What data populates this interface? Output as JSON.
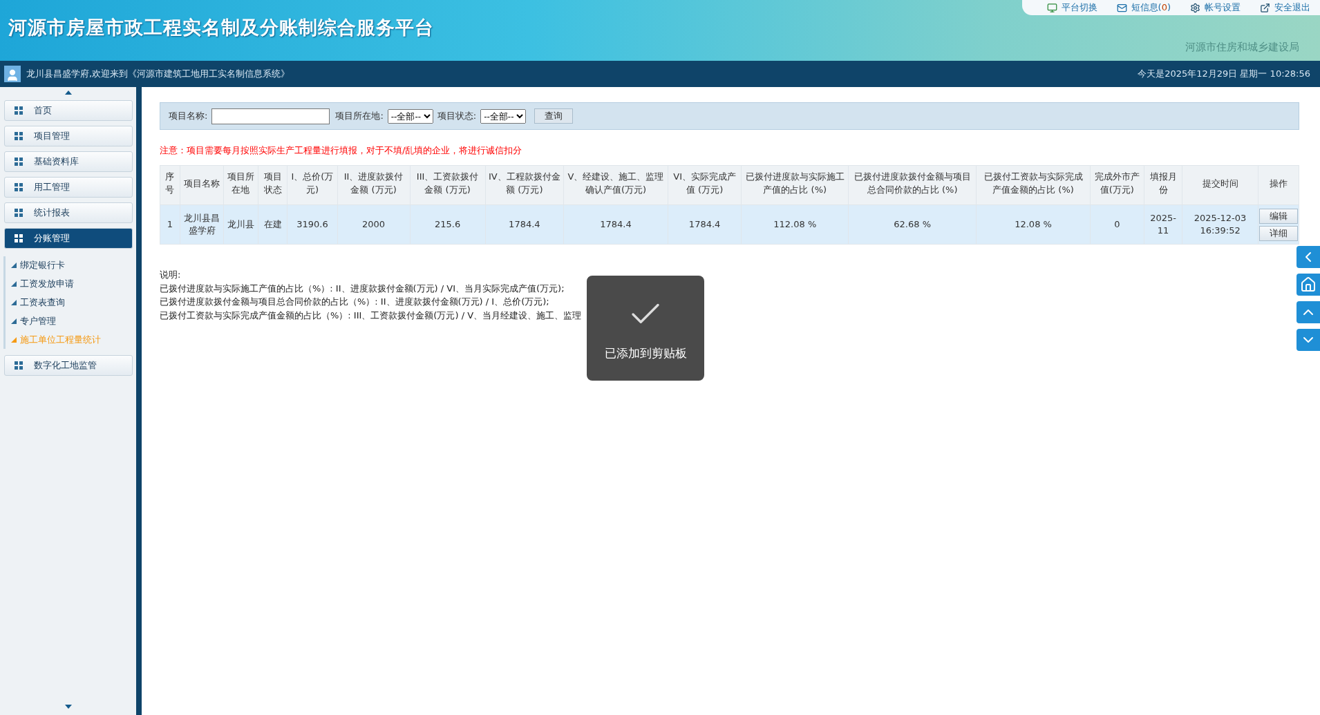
{
  "header": {
    "title": "河源市房屋市政工程实名制及分账制综合服务平台",
    "subtitle": "河源市住房和城乡建设局",
    "links": [
      {
        "kind": "platform",
        "label": "平台切换"
      },
      {
        "kind": "mail",
        "label": "短信息(",
        "count": "0",
        "suffix": ")"
      },
      {
        "kind": "settings",
        "label": "帐号设置"
      },
      {
        "kind": "logout",
        "label": "安全退出"
      }
    ]
  },
  "welcome_bar": {
    "welcome": "龙川县昌盛学府,欢迎来到《河源市建筑工地用工实名制信息系统》",
    "datetime": "今天是2025年12月29日 星期一 10:28:56"
  },
  "sidebar": {
    "items": [
      {
        "label": "首页",
        "selected": false
      },
      {
        "label": "项目管理",
        "selected": false
      },
      {
        "label": "基础资料库",
        "selected": false
      },
      {
        "label": "用工管理",
        "selected": false
      },
      {
        "label": "统计报表",
        "selected": false
      },
      {
        "label": "分账管理",
        "selected": true,
        "expanded": true,
        "children": [
          {
            "label": "绑定银行卡",
            "selected": false
          },
          {
            "label": "工资发放申请",
            "selected": false
          },
          {
            "label": "工资表查询",
            "selected": false
          },
          {
            "label": "专户管理",
            "selected": false
          },
          {
            "label": "施工单位工程量统计",
            "selected": true
          }
        ]
      },
      {
        "label": "数字化工地监管",
        "selected": false
      }
    ]
  },
  "filter": {
    "name_label": "项目名称:",
    "location_label": "项目所在地:",
    "location_value": "--全部--",
    "status_label": "项目状态:",
    "status_value": "--全部--",
    "query_button": "查询"
  },
  "notice": "注意：项目需要每月按照实际生产工程量进行填报，对于不填/乱填的企业，将进行诚信扣分",
  "table": {
    "columns": [
      "序号",
      "项目名称",
      "项目所在地",
      "项目状态",
      "I、总价(万元)",
      "II、进度款拨付金额 (万元)",
      "III、工资款拨付金额 (万元)",
      "IV、工程款拨付金额 (万元)",
      "V、经建设、施工、监理确认产值(万元)",
      "VI、实际完成产值 (万元)",
      "已拨付进度款与实际施工产值的占比 (%)",
      "已拨付进度款拨付金额与项目总合同价款的占比 (%)",
      "已拨付工资款与实际完成产值金额的占比 (%)",
      "完成外市产值(万元)",
      "填报月份",
      "提交时间",
      "操作"
    ],
    "rows": [
      {
        "selected": true,
        "cells": [
          "1",
          "龙川县昌盛学府",
          "龙川县",
          "在建",
          "3190.6",
          "2000",
          "215.6",
          "1784.4",
          "1784.4",
          "1784.4",
          "112.08 %",
          "62.68 %",
          "12.08 %",
          "0",
          "2025-11",
          "2025-12-03 16:39:52"
        ],
        "actions": [
          "编辑",
          "详细"
        ]
      }
    ]
  },
  "explanation": {
    "title": "说明:",
    "lines": [
      "已拨付进度款与实际施工产值的占比（%）: II、进度款拨付金额(万元) / VI、当月实际完成产值(万元);",
      "已拨付进度款拨付金额与项目总合同价款的占比（%）: II、进度款拨付金额(万元) / I、总价(万元);",
      "已拨付工资款与实际完成产值金额的占比（%）: III、工资款拨付金额(万元) / V、当月经建设、施工、监理"
    ]
  },
  "toast": {
    "message": "已添加到剪贴板"
  }
}
